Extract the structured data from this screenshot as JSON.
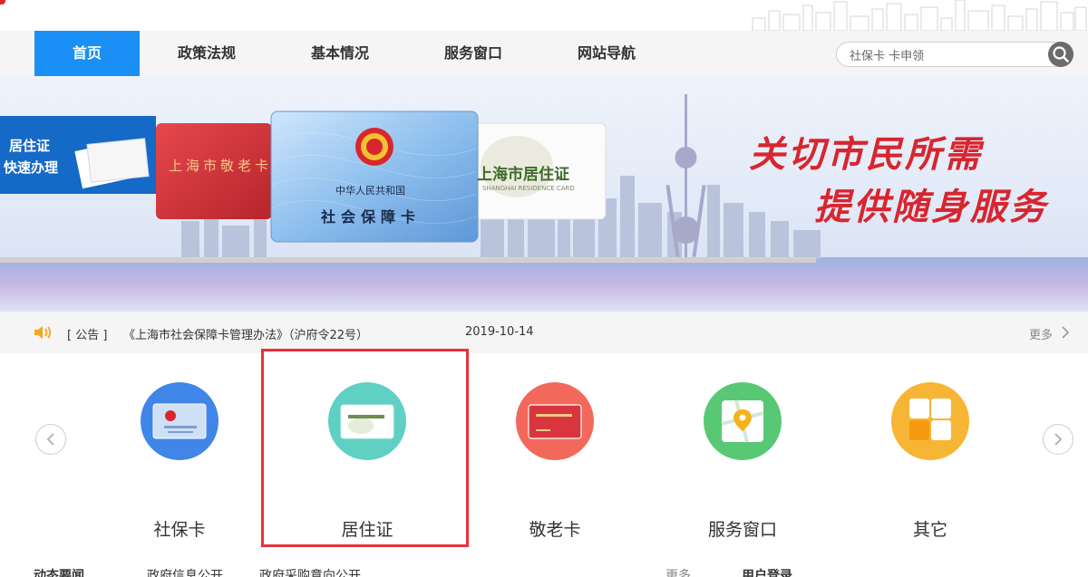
{
  "nav": {
    "items": [
      {
        "label": "首页",
        "active": true
      },
      {
        "label": "政策法规",
        "active": false
      },
      {
        "label": "基本情况",
        "active": false
      },
      {
        "label": "服务窗口",
        "active": false
      },
      {
        "label": "网站导航",
        "active": false
      }
    ]
  },
  "search": {
    "value": "社保卡 卡申领",
    "icon": "search-icon"
  },
  "banner": {
    "slogan_line1": "关切市民所需",
    "slogan_line2": "提供随身服务",
    "tile_line1": "居住证",
    "tile_line2": "快速办理",
    "card_red": "上海市敬老卡",
    "card_blue_line1": "中华人民共和国",
    "card_blue_line2": "社会保障卡",
    "card_white_line1": "上海市居住证",
    "card_white_line2": "SHANGHAI RESIDENCE CARD"
  },
  "notice": {
    "icon": "speaker-icon",
    "tag": "[ 公告 ]",
    "title": "《上海市社会保障卡管理办法》（沪府令22号）",
    "date": "2019-10-14",
    "more": "更多",
    "more_icon": "chevron-right-icon"
  },
  "services": [
    {
      "label": "社保卡",
      "icon": "social-security-card-icon",
      "color": "#3f86e8"
    },
    {
      "label": "居住证",
      "icon": "residence-permit-icon",
      "color": "#5fd0c2"
    },
    {
      "label": "敬老卡",
      "icon": "senior-card-icon",
      "color": "#f2685b"
    },
    {
      "label": "服务窗口",
      "icon": "map-location-icon",
      "color": "#58c875"
    },
    {
      "label": "其它",
      "icon": "apps-icon",
      "color": "#f7b535"
    }
  ],
  "carousel": {
    "prev_icon": "chevron-left-icon",
    "next_icon": "chevron-right-icon"
  },
  "bottom_tabs": [
    "动态要闻",
    "政府信息公开",
    "政府采购意向公开",
    "更多",
    "用户登录"
  ],
  "highlight_color": "#e8323a"
}
